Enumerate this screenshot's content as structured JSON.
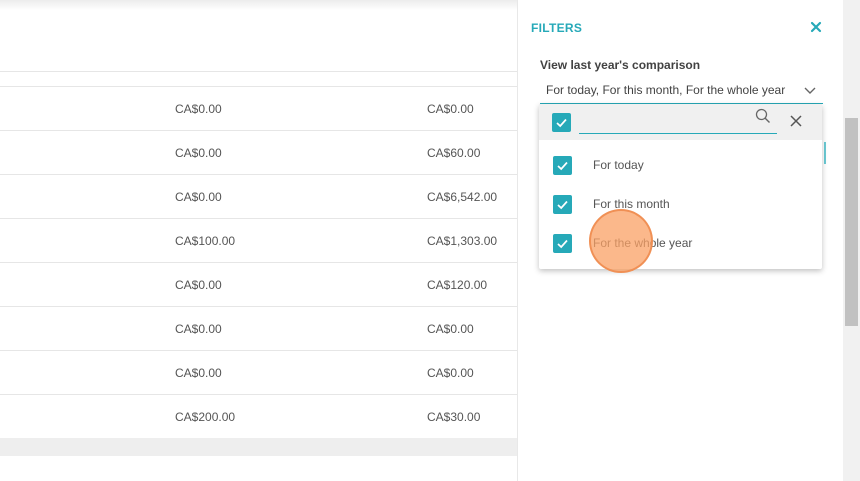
{
  "table": {
    "rows": [
      {
        "col1": "CA$0.00",
        "col2": "CA$0.00"
      },
      {
        "col1": "CA$0.00",
        "col2": "CA$60.00"
      },
      {
        "col1": "CA$0.00",
        "col2": "CA$6,542.00"
      },
      {
        "col1": "CA$100.00",
        "col2": "CA$1,303.00"
      },
      {
        "col1": "CA$0.00",
        "col2": "CA$120.00"
      },
      {
        "col1": "CA$0.00",
        "col2": "CA$0.00"
      },
      {
        "col1": "CA$0.00",
        "col2": "CA$0.00"
      },
      {
        "col1": "CA$200.00",
        "col2": "CA$30.00"
      }
    ]
  },
  "filters": {
    "title": "FILTERS",
    "close_icon": "close-icon",
    "comparison": {
      "label": "View last year's comparison",
      "value": "For today, For this month, For the whole year",
      "search_placeholder": "",
      "options": [
        {
          "label": "For today",
          "checked": true
        },
        {
          "label": "For this month",
          "checked": true
        },
        {
          "label": "For the whole year",
          "checked": true
        }
      ]
    }
  },
  "colors": {
    "accent": "#26a9b8",
    "click_indicator": "#f8a366"
  }
}
